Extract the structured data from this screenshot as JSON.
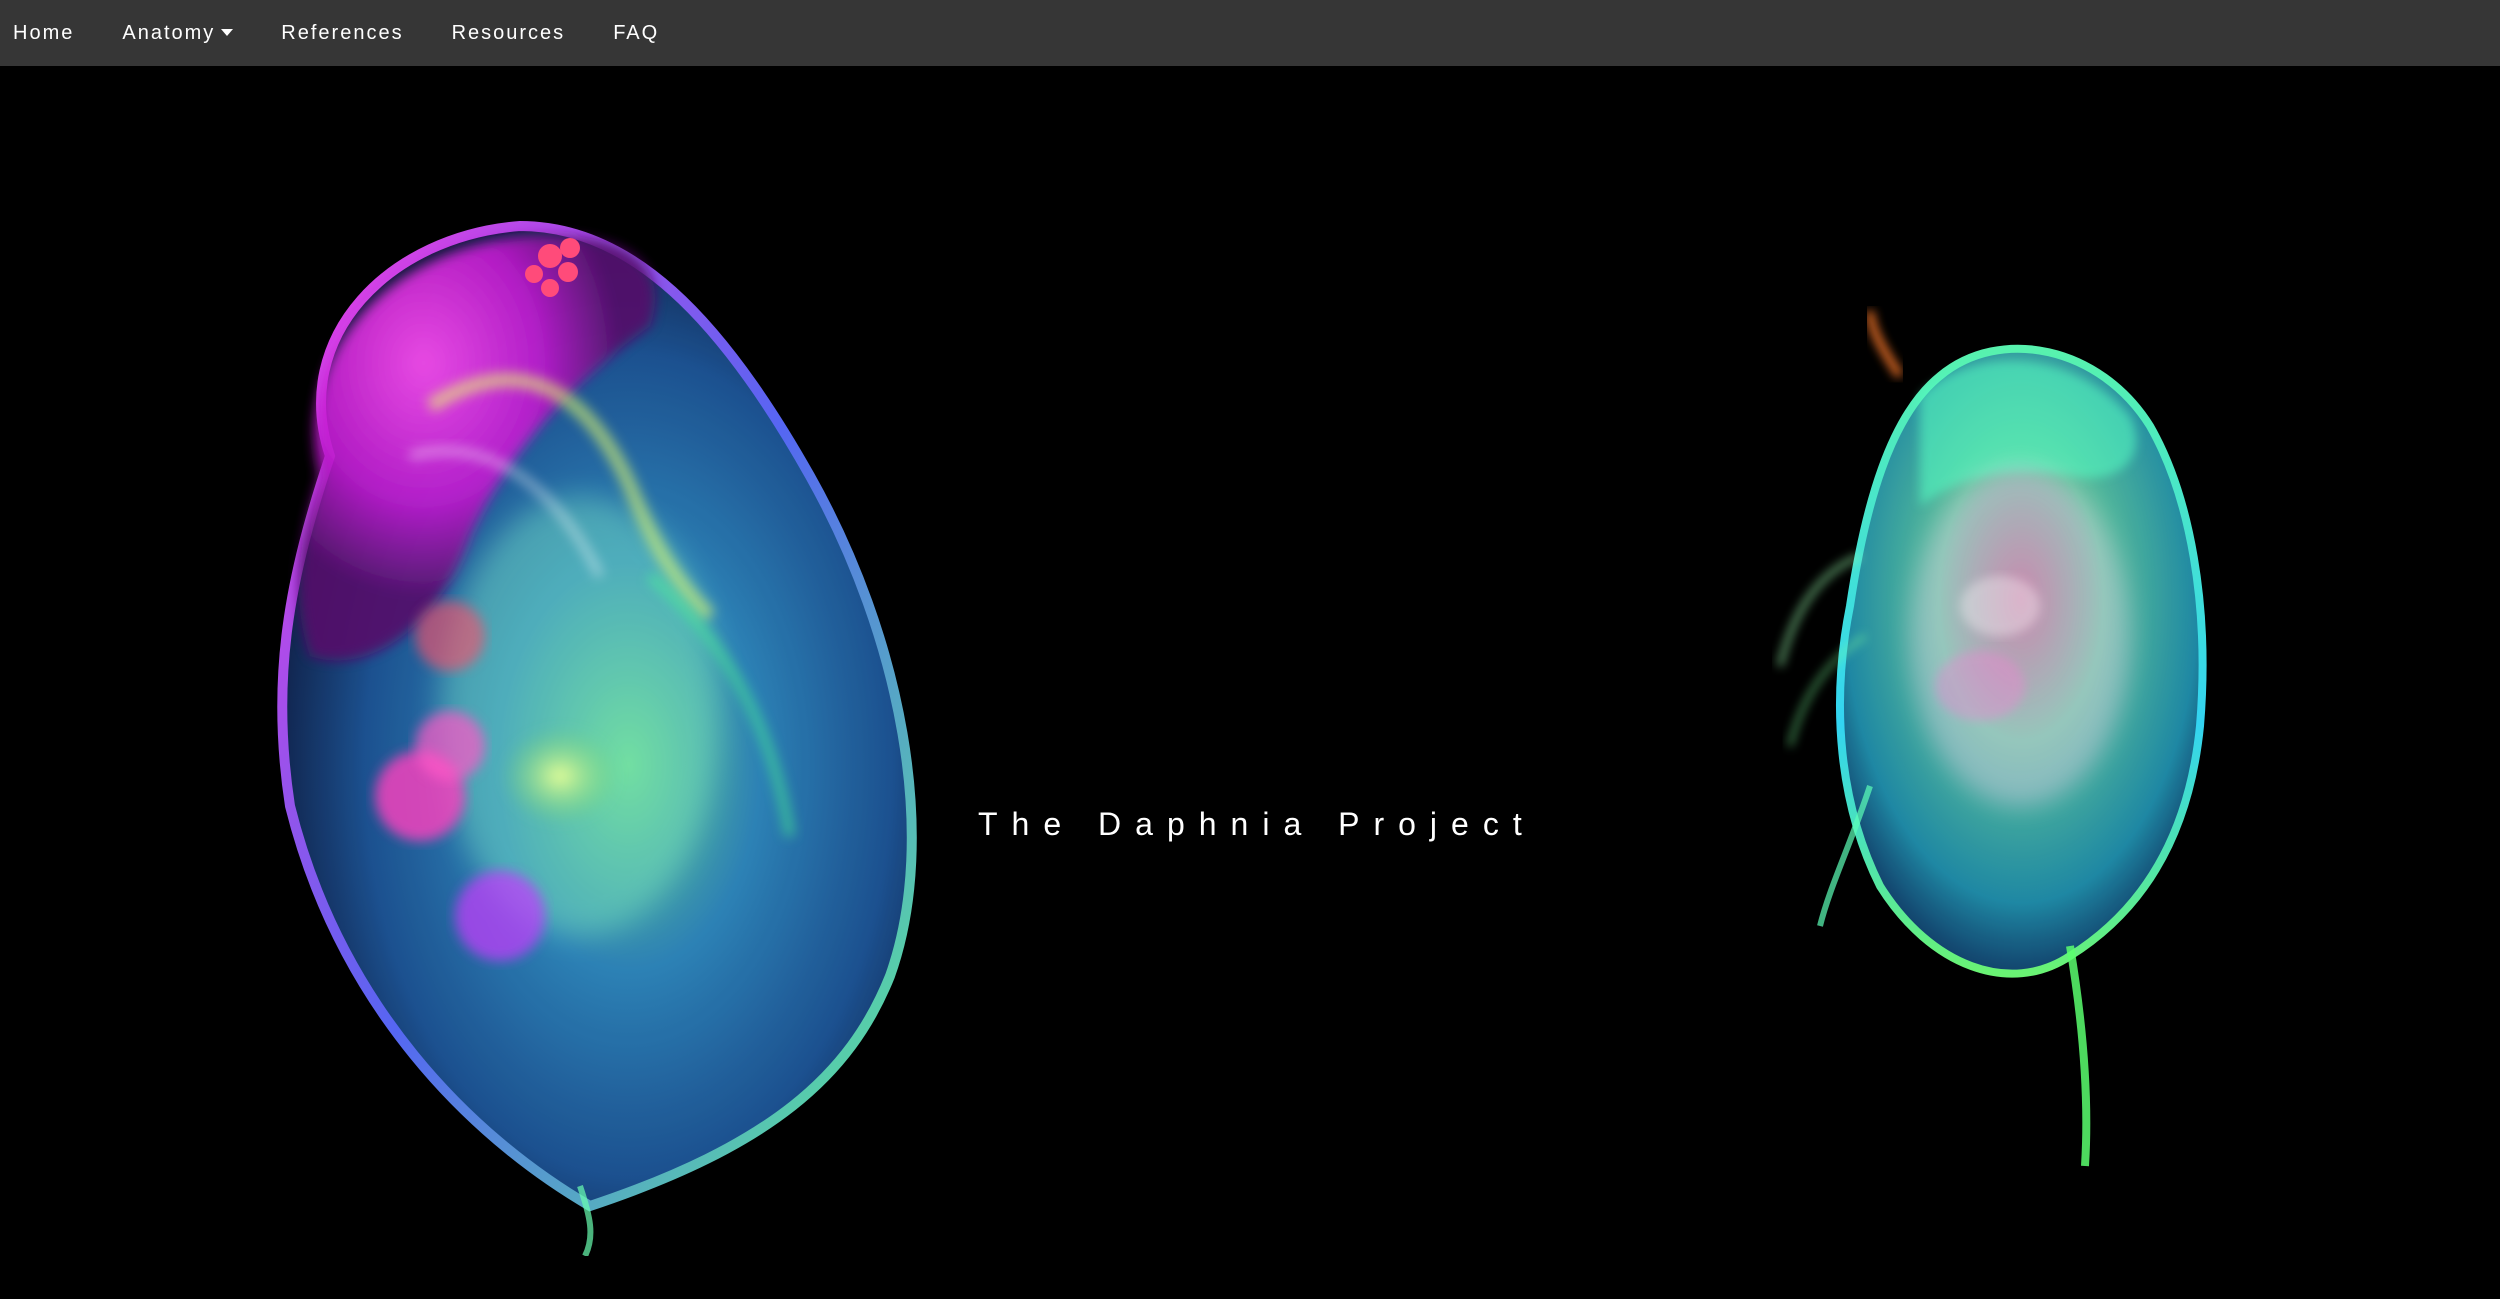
{
  "nav": {
    "items": [
      {
        "label": "Home"
      },
      {
        "label": "Anatomy"
      },
      {
        "label": "References"
      },
      {
        "label": "Resources"
      },
      {
        "label": "FAQ"
      }
    ]
  },
  "hero": {
    "title": "The Daphnia Project"
  },
  "colors": {
    "navbar_bg": "#363636",
    "page_bg": "#000000",
    "text": "#ffffff"
  }
}
